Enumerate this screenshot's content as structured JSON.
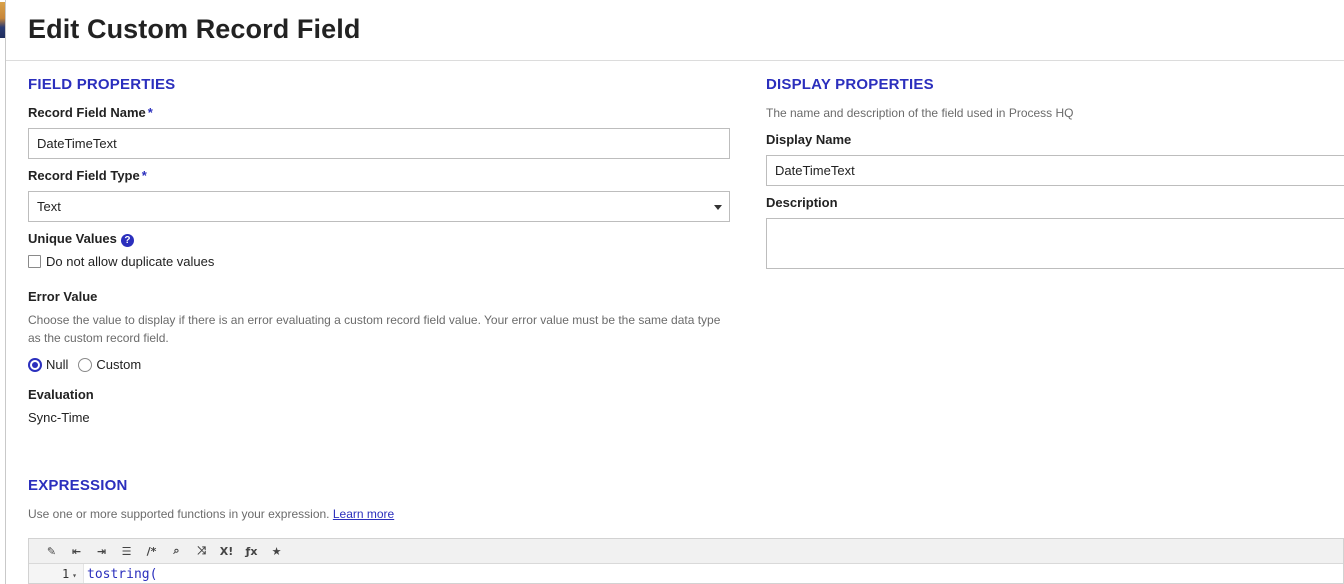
{
  "dialog": {
    "title": "Edit Custom Record Field"
  },
  "field_properties": {
    "section_title": "FIELD PROPERTIES",
    "record_field_name": {
      "label": "Record Field Name",
      "required_mark": "*",
      "value": "DateTimeText"
    },
    "record_field_type": {
      "label": "Record Field Type",
      "required_mark": "*",
      "selected": "Text"
    },
    "unique_values": {
      "label": "Unique Values",
      "help_icon": "question-circle-icon",
      "help_glyph": "?",
      "checkbox_label": "Do not allow duplicate values",
      "checked": false
    },
    "error_value": {
      "label": "Error Value",
      "help_text": "Choose the value to display if there is an error evaluating a custom record field value. Your error value must be the same data type as the custom record field.",
      "options": [
        "Null",
        "Custom"
      ],
      "selected": "Null"
    },
    "evaluation": {
      "label": "Evaluation",
      "value": "Sync-Time"
    }
  },
  "display_properties": {
    "section_title": "DISPLAY PROPERTIES",
    "help_text": "The name and description of the field used in Process HQ",
    "display_name": {
      "label": "Display Name",
      "value": "DateTimeText"
    },
    "description": {
      "label": "Description",
      "value": ""
    }
  },
  "expression": {
    "section_title": "EXPRESSION",
    "help_text": "Use one or more supported functions in your expression.",
    "learn_more": "Learn more",
    "toolbar": {
      "items": [
        {
          "name": "format-icon",
          "glyph": "✎"
        },
        {
          "name": "outdent-icon",
          "glyph": "⇤"
        },
        {
          "name": "indent-icon",
          "glyph": "⇥"
        },
        {
          "name": "list-icon",
          "glyph": "☰"
        },
        {
          "name": "comment-icon",
          "glyph": "/*"
        },
        {
          "name": "search-icon",
          "glyph": "⌕"
        },
        {
          "name": "shuffle-icon",
          "glyph": "⤨"
        },
        {
          "name": "factorial-icon",
          "glyph": "X!"
        },
        {
          "name": "function-icon",
          "glyph": "ƒx"
        },
        {
          "name": "star-icon",
          "glyph": "★"
        }
      ]
    },
    "code": {
      "line_number": "1",
      "fold_glyph": "▾",
      "line_1": "tostring("
    }
  },
  "colors": {
    "accent": "#2b2fbd",
    "muted_text": "#6b6b6b",
    "border": "#bdbdbd"
  }
}
